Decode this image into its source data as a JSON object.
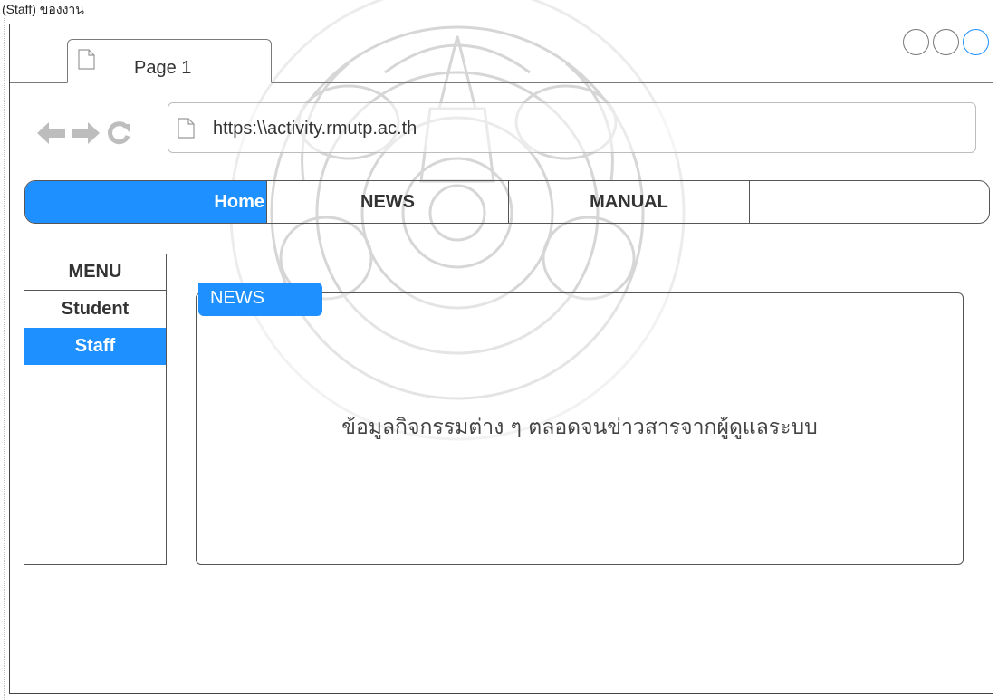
{
  "caption": "(Staff) ของงาน",
  "tab": {
    "title": "Page 1",
    "icon": "page-icon"
  },
  "window_controls": [
    "circle-button",
    "circle-button",
    "circle-button-active"
  ],
  "nav": {
    "back_icon": "back-arrow-icon",
    "forward_icon": "forward-arrow-icon",
    "reload_icon": "reload-icon"
  },
  "address": {
    "url": "https:\\\\activity.rmutp.ac.th",
    "icon": "page-icon"
  },
  "menubar": {
    "home": "Home",
    "news": "NEWS",
    "manual": "MANUAL",
    "active": "Home"
  },
  "sidebar": {
    "title": "MENU",
    "items": [
      "Student",
      "Staff"
    ],
    "active": "Staff"
  },
  "panel": {
    "tab_label": "NEWS",
    "content": "ข้อมูลกิจกรรมต่าง ๆ ตลอดจนข่าวสารจากผู้ดูแลระบบ"
  },
  "colors": {
    "accent": "#1e90ff",
    "border": "#555555",
    "text": "#333333"
  }
}
